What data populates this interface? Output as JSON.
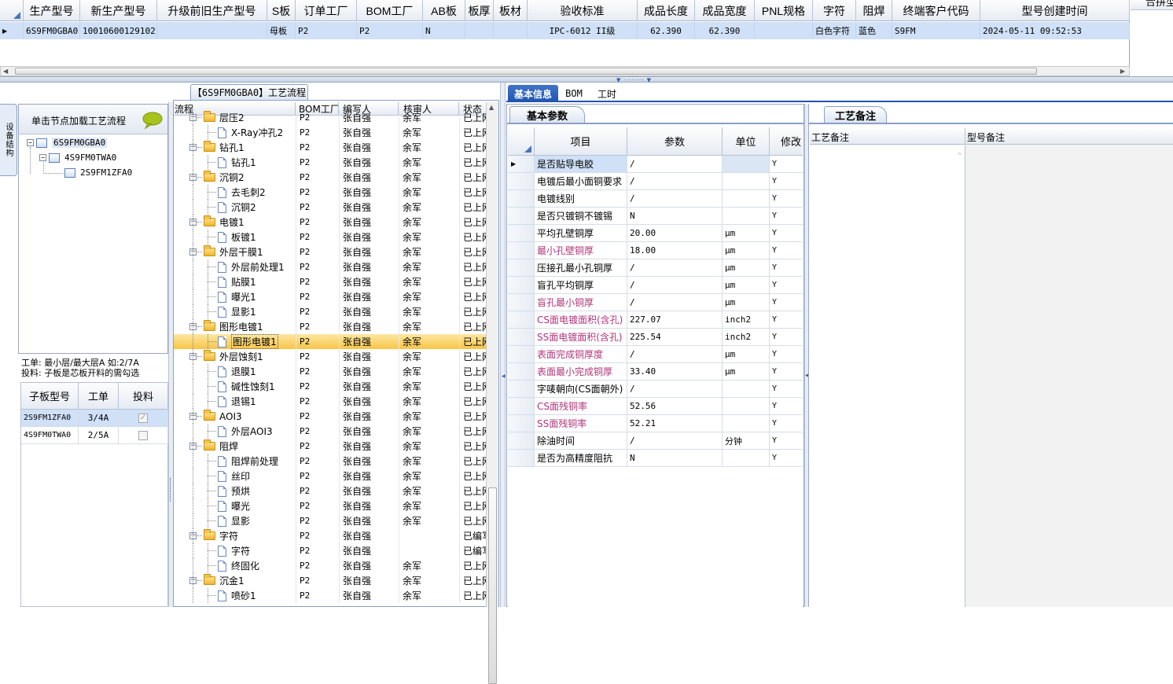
{
  "top_grid": {
    "headers": [
      "生产型号",
      "新生产型号",
      "升级前旧生产型号",
      "S板",
      "订单工厂",
      "BOM工厂",
      "AB板",
      "板厚",
      "板材",
      "验收标准",
      "成品长度",
      "成品宽度",
      "PNL规格",
      "字符",
      "阻焊",
      "终端客户代码",
      "型号创建时间"
    ],
    "row": [
      "6S9FM0GBA0",
      "10010600129102",
      "",
      "母板",
      "P2",
      "P2",
      "N",
      "",
      "",
      "IPC-6012 II级",
      "62.390",
      "62.390",
      "",
      "白色字符",
      "蓝色",
      "S9FM",
      "2024-05-11 09:52:53"
    ],
    "right_header": "合拼型"
  },
  "flow_title": "【6S9FM0GBA0】工艺流程",
  "left_vtab": "设备结构",
  "load_hint": "单击节点加载工艺流程",
  "tree": [
    "6S9FM0GBA0",
    "4S9FM0TWA0",
    "2S9FM1ZFA0"
  ],
  "notes": {
    "line1": "工单: 最小层/最大层A 如:2/7A",
    "line2": "投料: 子板是芯板开料的需勾选"
  },
  "sub_table": {
    "headers": [
      "子板型号",
      "工单",
      "投料"
    ],
    "rows": [
      {
        "model": "2S9FM1ZFA0",
        "order": "3/4A",
        "checked": true
      },
      {
        "model": "4S9FM0TWA0",
        "order": "2/5A",
        "checked": false
      }
    ]
  },
  "flow_headers": [
    "流程",
    "BOM工厂",
    "编写人",
    "核审人",
    "状态"
  ],
  "flow_rows": [
    {
      "name": "层压2",
      "type": "folder",
      "bom": "P2",
      "writer": "张自强",
      "reviewer": "余军",
      "status": "已上网"
    },
    {
      "name": "X-Ray冲孔2",
      "type": "doc",
      "bom": "P2",
      "writer": "张自强",
      "reviewer": "余军",
      "status": "已上网"
    },
    {
      "name": "钻孔1",
      "type": "folder",
      "bom": "P2",
      "writer": "张自强",
      "reviewer": "余军",
      "status": "已上网"
    },
    {
      "name": "钻孔1",
      "type": "doc",
      "bom": "P2",
      "writer": "张自强",
      "reviewer": "余军",
      "status": "已上网"
    },
    {
      "name": "沉铜2",
      "type": "folder",
      "bom": "P2",
      "writer": "张自强",
      "reviewer": "余军",
      "status": "已上网"
    },
    {
      "name": "去毛刺2",
      "type": "doc",
      "bom": "P2",
      "writer": "张自强",
      "reviewer": "余军",
      "status": "已上网"
    },
    {
      "name": "沉铜2",
      "type": "doc",
      "bom": "P2",
      "writer": "张自强",
      "reviewer": "余军",
      "status": "已上网"
    },
    {
      "name": "电镀1",
      "type": "folder",
      "bom": "P2",
      "writer": "张自强",
      "reviewer": "余军",
      "status": "已上网"
    },
    {
      "name": "板镀1",
      "type": "doc",
      "bom": "P2",
      "writer": "张自强",
      "reviewer": "余军",
      "status": "已上网"
    },
    {
      "name": "外层干膜1",
      "type": "folder",
      "bom": "P2",
      "writer": "张自强",
      "reviewer": "余军",
      "status": "已上网"
    },
    {
      "name": "外层前处理1",
      "type": "doc",
      "bom": "P2",
      "writer": "张自强",
      "reviewer": "余军",
      "status": "已上网"
    },
    {
      "name": "贴膜1",
      "type": "doc",
      "bom": "P2",
      "writer": "张自强",
      "reviewer": "余军",
      "status": "已上网"
    },
    {
      "name": "曝光1",
      "type": "doc",
      "bom": "P2",
      "writer": "张自强",
      "reviewer": "余军",
      "status": "已上网"
    },
    {
      "name": "显影1",
      "type": "doc",
      "bom": "P2",
      "writer": "张自强",
      "reviewer": "余军",
      "status": "已上网"
    },
    {
      "name": "图形电镀1",
      "type": "folder",
      "bom": "P2",
      "writer": "张自强",
      "reviewer": "余军",
      "status": "已上网"
    },
    {
      "name": "图形电镀1",
      "type": "doc",
      "bom": "P2",
      "writer": "张自强",
      "reviewer": "余军",
      "status": "已上网",
      "selected": true
    },
    {
      "name": "外层蚀刻1",
      "type": "folder",
      "bom": "P2",
      "writer": "张自强",
      "reviewer": "余军",
      "status": "已上网"
    },
    {
      "name": "退膜1",
      "type": "doc",
      "bom": "P2",
      "writer": "张自强",
      "reviewer": "余军",
      "status": "已上网"
    },
    {
      "name": "碱性蚀刻1",
      "type": "doc",
      "bom": "P2",
      "writer": "张自强",
      "reviewer": "余军",
      "status": "已上网"
    },
    {
      "name": "退锡1",
      "type": "doc",
      "bom": "P2",
      "writer": "张自强",
      "reviewer": "余军",
      "status": "已上网"
    },
    {
      "name": "AOI3",
      "type": "folder",
      "bom": "P2",
      "writer": "张自强",
      "reviewer": "余军",
      "status": "已上网"
    },
    {
      "name": "外层AOI3",
      "type": "doc",
      "bom": "P2",
      "writer": "张自强",
      "reviewer": "余军",
      "status": "已上网"
    },
    {
      "name": "阻焊",
      "type": "folder",
      "bom": "P2",
      "writer": "张自强",
      "reviewer": "余军",
      "status": "已上网"
    },
    {
      "name": "阻焊前处理",
      "type": "doc",
      "bom": "P2",
      "writer": "张自强",
      "reviewer": "余军",
      "status": "已上网"
    },
    {
      "name": "丝印",
      "type": "doc",
      "bom": "P2",
      "writer": "张自强",
      "reviewer": "余军",
      "status": "已上网"
    },
    {
      "name": "预烘",
      "type": "doc",
      "bom": "P2",
      "writer": "张自强",
      "reviewer": "余军",
      "status": "已上网"
    },
    {
      "name": "曝光",
      "type": "doc",
      "bom": "P2",
      "writer": "张自强",
      "reviewer": "余军",
      "status": "已上网"
    },
    {
      "name": "显影",
      "type": "doc",
      "bom": "P2",
      "writer": "张自强",
      "reviewer": "余军",
      "status": "已上网"
    },
    {
      "name": "字符",
      "type": "folder",
      "bom": "P2",
      "writer": "张自强",
      "reviewer": "",
      "status": "已编写"
    },
    {
      "name": "字符",
      "type": "doc",
      "bom": "P2",
      "writer": "张自强",
      "reviewer": "",
      "status": "已编写"
    },
    {
      "name": "终固化",
      "type": "doc",
      "bom": "P2",
      "writer": "张自强",
      "reviewer": "余军",
      "status": "已上网"
    },
    {
      "name": "沉金1",
      "type": "folder",
      "bom": "P2",
      "writer": "张自强",
      "reviewer": "余军",
      "status": "已上网"
    },
    {
      "name": "喷砂1",
      "type": "doc",
      "bom": "P2",
      "writer": "张自强",
      "reviewer": "余军",
      "status": "已上网"
    }
  ],
  "tabs": [
    "基本信息",
    "BOM",
    "工时"
  ],
  "basic_params_tab": "基本参数",
  "param_headers": [
    "项目",
    "参数",
    "单位",
    "修改"
  ],
  "params": [
    {
      "item": "是否贴导电胶",
      "value": "/",
      "unit": "",
      "mod": "Y",
      "pink": false,
      "current": true
    },
    {
      "item": "电镀后最小面铜要求",
      "value": "/",
      "unit": "",
      "mod": "Y",
      "pink": false
    },
    {
      "item": "电镀线别",
      "value": "/",
      "unit": "",
      "mod": "Y",
      "pink": false
    },
    {
      "item": "是否只镀铜不镀锡",
      "value": "N",
      "unit": "",
      "mod": "Y",
      "pink": false
    },
    {
      "item": "平均孔壁铜厚",
      "value": "20.00",
      "unit": "μm",
      "mod": "Y",
      "pink": false
    },
    {
      "item": "最小孔壁铜厚",
      "value": "18.00",
      "unit": "μm",
      "mod": "Y",
      "pink": true
    },
    {
      "item": "压接孔最小孔铜厚",
      "value": "/",
      "unit": "μm",
      "mod": "Y",
      "pink": false
    },
    {
      "item": "盲孔平均铜厚",
      "value": "/",
      "unit": "μm",
      "mod": "Y",
      "pink": false
    },
    {
      "item": "盲孔最小铜厚",
      "value": "/",
      "unit": "μm",
      "mod": "Y",
      "pink": true
    },
    {
      "item": "CS面电镀面积(含孔)",
      "value": "227.07",
      "unit": "inch2",
      "mod": "Y",
      "pink": true
    },
    {
      "item": "SS面电镀面积(含孔)",
      "value": "225.54",
      "unit": "inch2",
      "mod": "Y",
      "pink": true
    },
    {
      "item": "表面完成铜厚度",
      "value": "/",
      "unit": "μm",
      "mod": "Y",
      "pink": true
    },
    {
      "item": "表面最小完成铜厚",
      "value": "33.40",
      "unit": "μm",
      "mod": "Y",
      "pink": true
    },
    {
      "item": "字唛朝向(CS面朝外)",
      "value": "/",
      "unit": "",
      "mod": "Y",
      "pink": false
    },
    {
      "item": "CS面残铜率",
      "value": "52.56",
      "unit": "",
      "mod": "Y",
      "pink": true
    },
    {
      "item": "SS面残铜率",
      "value": "52.21",
      "unit": "",
      "mod": "Y",
      "pink": true
    },
    {
      "item": "除油时间",
      "value": "/",
      "unit": "分钟",
      "mod": "Y",
      "pink": false
    },
    {
      "item": "是否为高精度阻抗",
      "value": "N",
      "unit": "",
      "mod": "Y",
      "pink": false
    }
  ],
  "process_notes_tab": "工艺备注",
  "notes_headers": [
    "工艺备注",
    "型号备注"
  ],
  "colors": {
    "accent": "#1f55b0",
    "selection": "#cfe0f7",
    "highlight": "#fbd36a",
    "pink": "#b0357a"
  }
}
